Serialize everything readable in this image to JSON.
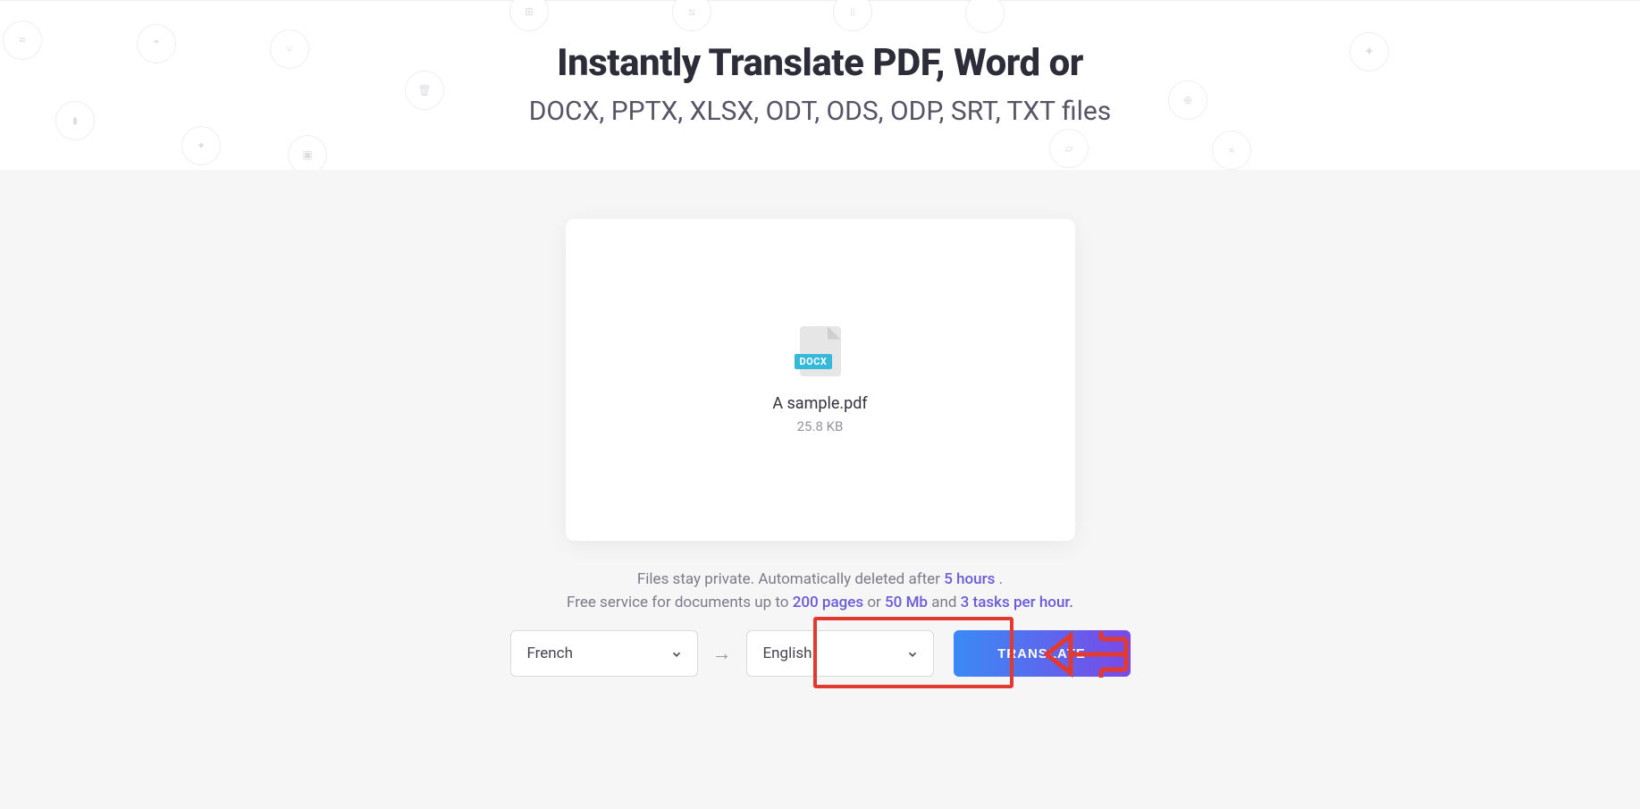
{
  "header": {
    "title": "Instantly Translate PDF, Word or",
    "subtitle": "DOCX, PPTX, XLSX, ODT, ODS, ODP, SRT, TXT files"
  },
  "upload": {
    "badge": "DOCX",
    "file_name": "A sample.pdf",
    "file_size": "25.8 KB"
  },
  "info": {
    "line1_pre": "Files stay private. Automatically deleted after ",
    "line1_link": "5 hours",
    "line1_post": " .",
    "line2_pre": "Free service for documents up to ",
    "line2_link1": "200 pages",
    "line2_mid1": " or ",
    "line2_link2": "50 Mb",
    "line2_mid2": " and ",
    "line2_link3": "3 tasks per hour."
  },
  "controls": {
    "source_lang": "French",
    "target_lang": "English",
    "translate_label": "TRANSLATE",
    "arrow_glyph": "→"
  }
}
